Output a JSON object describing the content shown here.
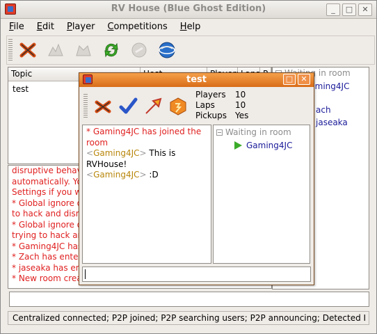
{
  "main": {
    "title": "RV House (Blue Ghost Edition)",
    "menu": [
      "File",
      "Edit",
      "Player",
      "Competitions",
      "Help"
    ],
    "toolbar_icons": [
      "close-x-icon",
      "host-room-icon",
      "join-room-icon",
      "refresh-icon",
      "disabled-icon",
      "globe-icon"
    ],
    "room_columns": [
      "Topic",
      "Host",
      "Players",
      "Laps",
      "P"
    ],
    "rooms": [
      {
        "topic": "test"
      }
    ],
    "user_tree": {
      "header": "Waiting in room",
      "users": [
        "Gaming4JC",
        "ach",
        "jaseaka"
      ]
    },
    "chat": [
      {
        "text": "disruptive behav",
        "color": "red"
      },
      {
        "text": "automatically. Yo",
        "color": "red"
      },
      {
        "text": "Settings if you w",
        "color": "red"
      },
      {
        "text": "* Global ignore o",
        "color": "red"
      },
      {
        "text": "to hack and disr",
        "color": "red"
      },
      {
        "text": "* Global ignore o",
        "color": "red"
      },
      {
        "text": "trying to hack an",
        "color": "red"
      },
      {
        "text": "* Gaming4JC has",
        "color": "red"
      },
      {
        "text": "* Zach has ente",
        "color": "red"
      },
      {
        "text": "* jaseaka has en",
        "color": "red"
      },
      {
        "text": "* New room crea",
        "color": "red"
      }
    ],
    "status": "Centralized connected; P2P joined; P2P searching users; P2P announcing; Detected I"
  },
  "room": {
    "title": "test",
    "toolbar_icons": [
      "leave-room-icon",
      "ready-check-icon",
      "launch-icon",
      "settings-badge-icon"
    ],
    "settings": [
      {
        "label": "Players",
        "value": "10"
      },
      {
        "label": "Laps",
        "value": "10"
      },
      {
        "label": "Pickups",
        "value": "Yes"
      }
    ],
    "chat": {
      "joined": "* Gaming4JC has joined the room",
      "user": "Gaming4JC",
      "msg1": "This is RVHouse!",
      "msg2": ":D"
    },
    "user_tree": {
      "header": "Waiting in room",
      "user": "Gaming4JC"
    }
  },
  "colors": {
    "accent_orange": "#e07a22",
    "chat_red": "#e02020",
    "user_blue": "#1a1a9a",
    "nick_gold": "#b8860b"
  }
}
